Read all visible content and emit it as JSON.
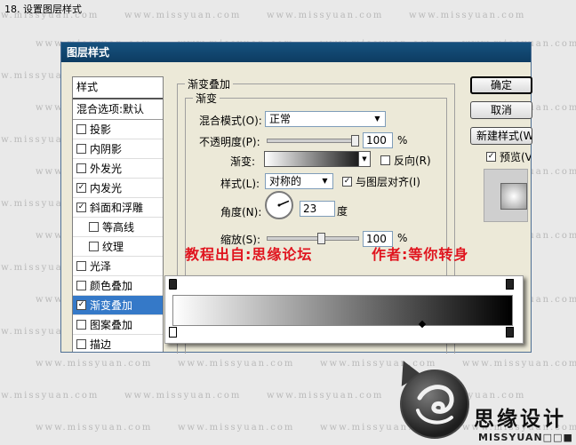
{
  "step_title": "18. 设置图层样式",
  "watermark_text": "www.missyuan.com",
  "dialog": {
    "title": "图层样式",
    "styles_header": "样式",
    "blending_options": "混合选项:默认",
    "layer_styles": [
      {
        "label": "投影",
        "checked": false,
        "sub": false,
        "selected": false
      },
      {
        "label": "内阴影",
        "checked": false,
        "sub": false,
        "selected": false
      },
      {
        "label": "外发光",
        "checked": false,
        "sub": false,
        "selected": false
      },
      {
        "label": "内发光",
        "checked": true,
        "sub": false,
        "selected": false
      },
      {
        "label": "斜面和浮雕",
        "checked": true,
        "sub": false,
        "selected": false
      },
      {
        "label": "等高线",
        "checked": false,
        "sub": true,
        "selected": false
      },
      {
        "label": "纹理",
        "checked": false,
        "sub": true,
        "selected": false
      },
      {
        "label": "光泽",
        "checked": false,
        "sub": false,
        "selected": false
      },
      {
        "label": "颜色叠加",
        "checked": false,
        "sub": false,
        "selected": false
      },
      {
        "label": "渐变叠加",
        "checked": true,
        "sub": false,
        "selected": true
      },
      {
        "label": "图案叠加",
        "checked": false,
        "sub": false,
        "selected": false
      },
      {
        "label": "描边",
        "checked": false,
        "sub": false,
        "selected": false
      }
    ],
    "section_title": "渐变叠加",
    "subsection_title": "渐变",
    "blend_mode": {
      "label": "混合模式(O):",
      "value": "正常"
    },
    "opacity": {
      "label": "不透明度(P):",
      "value": "100",
      "unit": "%",
      "level": 1.0
    },
    "gradient": {
      "label": "渐变:",
      "reverse_label": "反向(R)",
      "reverse_checked": false
    },
    "style": {
      "label": "样式(L):",
      "value": "对称的",
      "align_label": "与图层对齐(I)",
      "align_checked": true
    },
    "angle": {
      "label": "角度(N):",
      "value": "23",
      "unit": "度"
    },
    "scale": {
      "label": "缩放(S):",
      "value": "100",
      "unit": "%",
      "level": 0.6
    },
    "buttons": {
      "ok": "确定",
      "cancel": "取消",
      "new_style": "新建样式(W)...",
      "preview": "预览(V)"
    },
    "preview_checked": true
  },
  "credits": {
    "source": "教程出自:思缘论坛",
    "author": "作者:等你转身"
  },
  "gradient_editor": {
    "start_color": "#ffffff",
    "end_color": "#000000",
    "midpoint_location": 0.75
  },
  "logo": {
    "cn": "思缘设计",
    "en": "MISSYUAN",
    "en_suffix": "□□■"
  }
}
